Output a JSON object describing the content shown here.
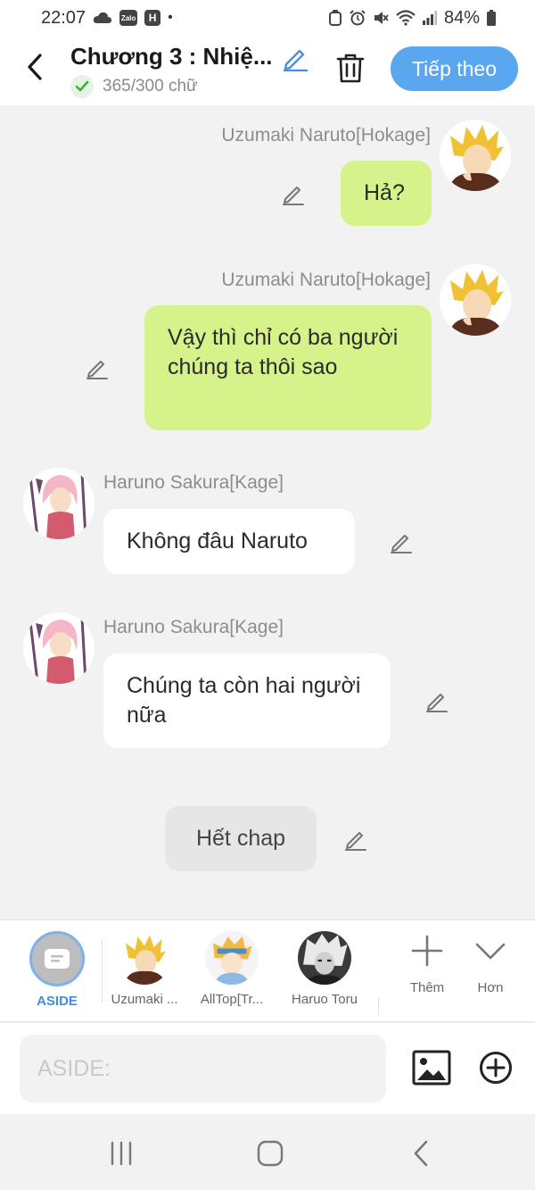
{
  "status_bar": {
    "time": "22:07",
    "battery": "84%",
    "zalo_badge": "Zalo",
    "h_badge": "H",
    "dot": "•"
  },
  "header": {
    "chapter_title": "Chương 3 : Nhiệ...",
    "word_count": "365/300 chữ",
    "next_button": "Tiếp theo"
  },
  "messages": [
    {
      "sender": "Uzumaki Naruto[Hokage]",
      "text": "Hả?",
      "side": "right"
    },
    {
      "sender": "Uzumaki Naruto[Hokage]",
      "text": "Vậy thì chỉ có ba người chúng ta thôi sao",
      "side": "right"
    },
    {
      "sender": "Haruno Sakura[Kage]",
      "text": "Không đâu Naruto",
      "side": "left"
    },
    {
      "sender": "Haruno Sakura[Kage]",
      "text": "Chúng ta còn hai người nữa",
      "side": "left"
    },
    {
      "sender": "",
      "text": "Hết chap",
      "side": "center"
    }
  ],
  "characters": [
    {
      "label": "ASIDE"
    },
    {
      "label": "Uzumaki ..."
    },
    {
      "label": "AllTop[Tr..."
    },
    {
      "label": "Haruo Toru"
    }
  ],
  "tools": {
    "add_label": "Thêm",
    "more_label": "Hơn"
  },
  "input": {
    "placeholder": "ASIDE:"
  },
  "colors": {
    "accent": "#5aa6ef",
    "bubble_green": "#d5f28b",
    "bubble_white": "#ffffff",
    "background": "#f2f2f2"
  }
}
